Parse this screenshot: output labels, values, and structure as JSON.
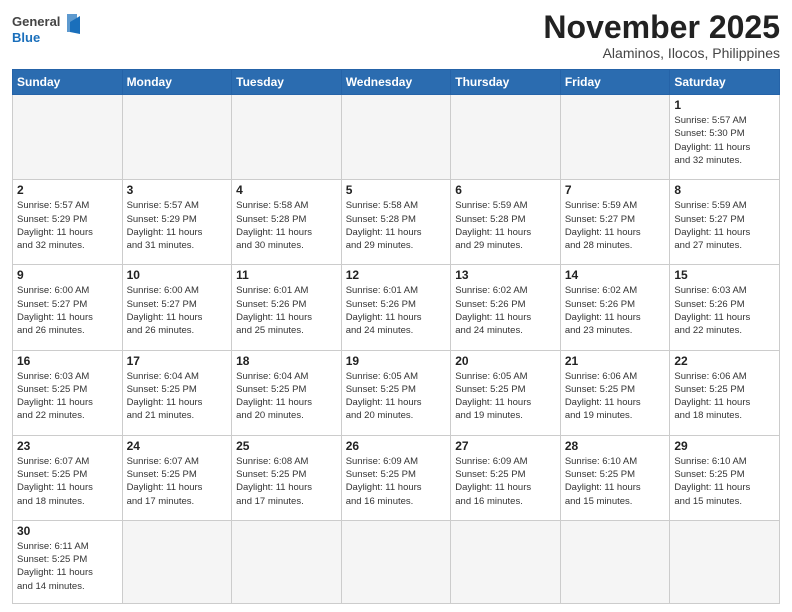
{
  "header": {
    "logo_general": "General",
    "logo_blue": "Blue",
    "month": "November 2025",
    "location": "Alaminos, Ilocos, Philippines"
  },
  "weekdays": [
    "Sunday",
    "Monday",
    "Tuesday",
    "Wednesday",
    "Thursday",
    "Friday",
    "Saturday"
  ],
  "weeks": [
    [
      {
        "day": "",
        "info": ""
      },
      {
        "day": "",
        "info": ""
      },
      {
        "day": "",
        "info": ""
      },
      {
        "day": "",
        "info": ""
      },
      {
        "day": "",
        "info": ""
      },
      {
        "day": "",
        "info": ""
      },
      {
        "day": "1",
        "info": "Sunrise: 5:57 AM\nSunset: 5:30 PM\nDaylight: 11 hours\nand 32 minutes."
      }
    ],
    [
      {
        "day": "2",
        "info": "Sunrise: 5:57 AM\nSunset: 5:29 PM\nDaylight: 11 hours\nand 32 minutes."
      },
      {
        "day": "3",
        "info": "Sunrise: 5:57 AM\nSunset: 5:29 PM\nDaylight: 11 hours\nand 31 minutes."
      },
      {
        "day": "4",
        "info": "Sunrise: 5:58 AM\nSunset: 5:28 PM\nDaylight: 11 hours\nand 30 minutes."
      },
      {
        "day": "5",
        "info": "Sunrise: 5:58 AM\nSunset: 5:28 PM\nDaylight: 11 hours\nand 29 minutes."
      },
      {
        "day": "6",
        "info": "Sunrise: 5:59 AM\nSunset: 5:28 PM\nDaylight: 11 hours\nand 29 minutes."
      },
      {
        "day": "7",
        "info": "Sunrise: 5:59 AM\nSunset: 5:27 PM\nDaylight: 11 hours\nand 28 minutes."
      },
      {
        "day": "8",
        "info": "Sunrise: 5:59 AM\nSunset: 5:27 PM\nDaylight: 11 hours\nand 27 minutes."
      }
    ],
    [
      {
        "day": "9",
        "info": "Sunrise: 6:00 AM\nSunset: 5:27 PM\nDaylight: 11 hours\nand 26 minutes."
      },
      {
        "day": "10",
        "info": "Sunrise: 6:00 AM\nSunset: 5:27 PM\nDaylight: 11 hours\nand 26 minutes."
      },
      {
        "day": "11",
        "info": "Sunrise: 6:01 AM\nSunset: 5:26 PM\nDaylight: 11 hours\nand 25 minutes."
      },
      {
        "day": "12",
        "info": "Sunrise: 6:01 AM\nSunset: 5:26 PM\nDaylight: 11 hours\nand 24 minutes."
      },
      {
        "day": "13",
        "info": "Sunrise: 6:02 AM\nSunset: 5:26 PM\nDaylight: 11 hours\nand 24 minutes."
      },
      {
        "day": "14",
        "info": "Sunrise: 6:02 AM\nSunset: 5:26 PM\nDaylight: 11 hours\nand 23 minutes."
      },
      {
        "day": "15",
        "info": "Sunrise: 6:03 AM\nSunset: 5:26 PM\nDaylight: 11 hours\nand 22 minutes."
      }
    ],
    [
      {
        "day": "16",
        "info": "Sunrise: 6:03 AM\nSunset: 5:25 PM\nDaylight: 11 hours\nand 22 minutes."
      },
      {
        "day": "17",
        "info": "Sunrise: 6:04 AM\nSunset: 5:25 PM\nDaylight: 11 hours\nand 21 minutes."
      },
      {
        "day": "18",
        "info": "Sunrise: 6:04 AM\nSunset: 5:25 PM\nDaylight: 11 hours\nand 20 minutes."
      },
      {
        "day": "19",
        "info": "Sunrise: 6:05 AM\nSunset: 5:25 PM\nDaylight: 11 hours\nand 20 minutes."
      },
      {
        "day": "20",
        "info": "Sunrise: 6:05 AM\nSunset: 5:25 PM\nDaylight: 11 hours\nand 19 minutes."
      },
      {
        "day": "21",
        "info": "Sunrise: 6:06 AM\nSunset: 5:25 PM\nDaylight: 11 hours\nand 19 minutes."
      },
      {
        "day": "22",
        "info": "Sunrise: 6:06 AM\nSunset: 5:25 PM\nDaylight: 11 hours\nand 18 minutes."
      }
    ],
    [
      {
        "day": "23",
        "info": "Sunrise: 6:07 AM\nSunset: 5:25 PM\nDaylight: 11 hours\nand 18 minutes."
      },
      {
        "day": "24",
        "info": "Sunrise: 6:07 AM\nSunset: 5:25 PM\nDaylight: 11 hours\nand 17 minutes."
      },
      {
        "day": "25",
        "info": "Sunrise: 6:08 AM\nSunset: 5:25 PM\nDaylight: 11 hours\nand 17 minutes."
      },
      {
        "day": "26",
        "info": "Sunrise: 6:09 AM\nSunset: 5:25 PM\nDaylight: 11 hours\nand 16 minutes."
      },
      {
        "day": "27",
        "info": "Sunrise: 6:09 AM\nSunset: 5:25 PM\nDaylight: 11 hours\nand 16 minutes."
      },
      {
        "day": "28",
        "info": "Sunrise: 6:10 AM\nSunset: 5:25 PM\nDaylight: 11 hours\nand 15 minutes."
      },
      {
        "day": "29",
        "info": "Sunrise: 6:10 AM\nSunset: 5:25 PM\nDaylight: 11 hours\nand 15 minutes."
      }
    ],
    [
      {
        "day": "30",
        "info": "Sunrise: 6:11 AM\nSunset: 5:25 PM\nDaylight: 11 hours\nand 14 minutes."
      },
      {
        "day": "",
        "info": ""
      },
      {
        "day": "",
        "info": ""
      },
      {
        "day": "",
        "info": ""
      },
      {
        "day": "",
        "info": ""
      },
      {
        "day": "",
        "info": ""
      },
      {
        "day": "",
        "info": ""
      }
    ]
  ]
}
